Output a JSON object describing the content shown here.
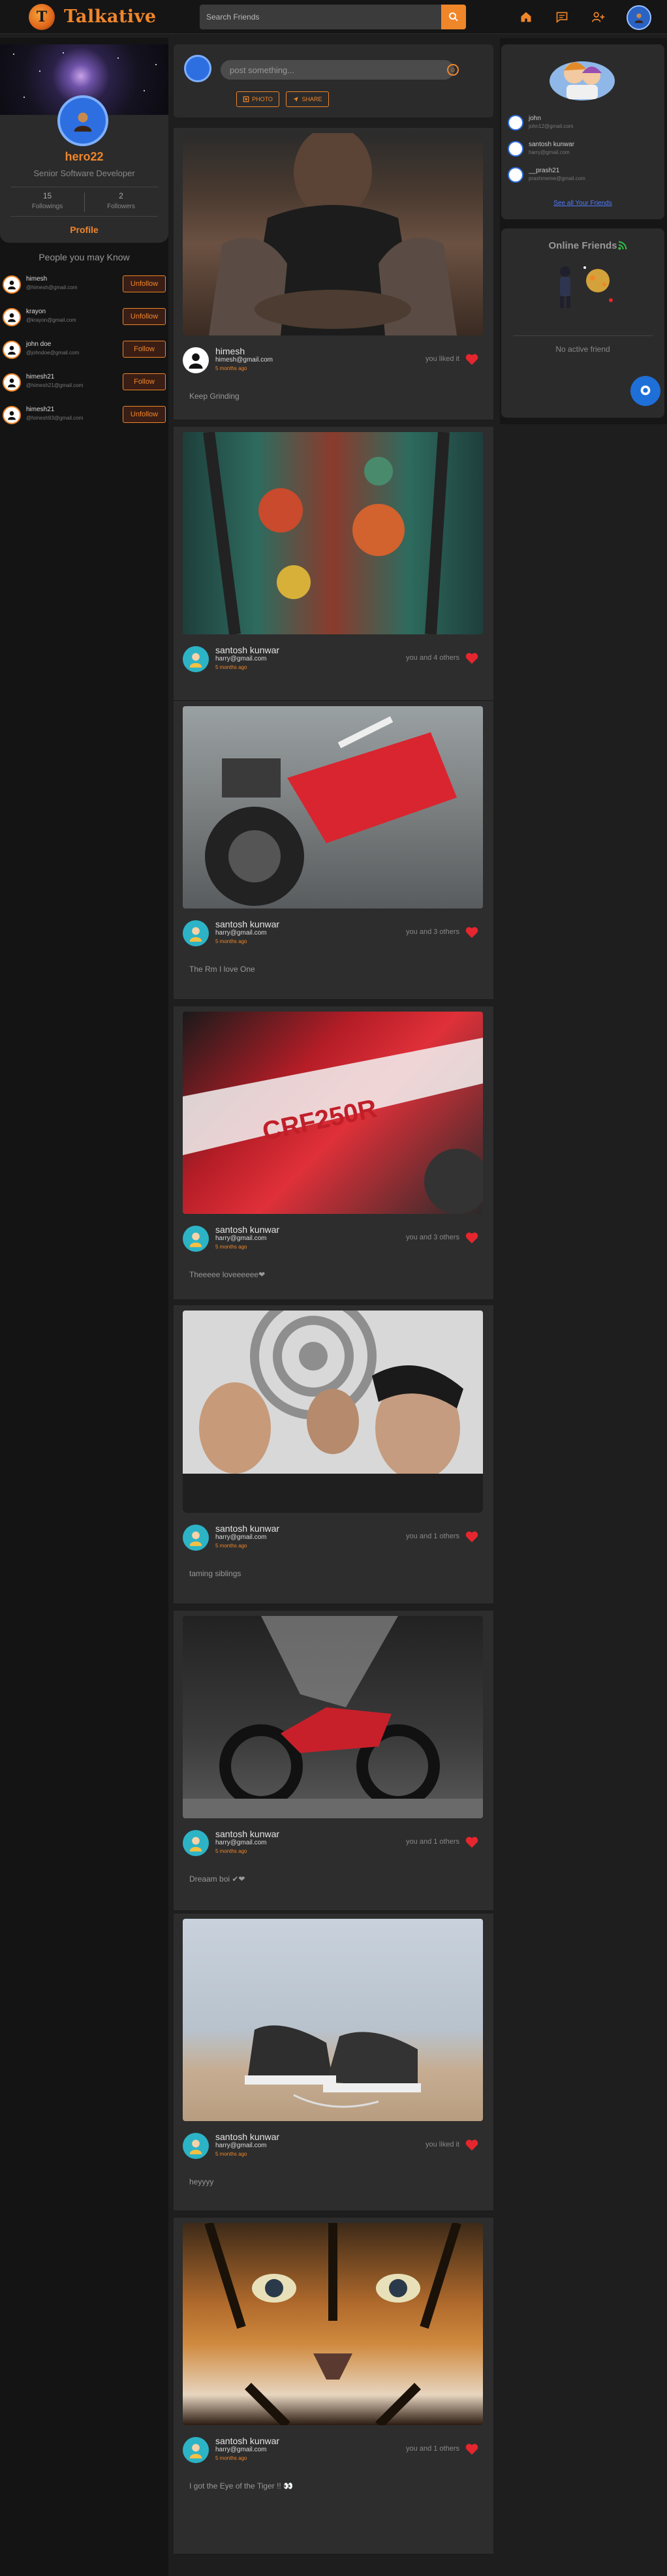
{
  "navbar": {
    "brand": "Talkative",
    "logo_letter": "T",
    "search_placeholder": "Search Friends",
    "icons": [
      "search-icon",
      "home-icon",
      "chat-icon",
      "person-add-icon",
      "user-avatar"
    ]
  },
  "profile": {
    "name": "hero22",
    "title": "Senior Software Developer",
    "followings_count": "15",
    "followings_label": "Followings",
    "followers_count": "2",
    "followers_label": "Followers",
    "link_label": "Profile"
  },
  "people_you_may_know": {
    "title": "People you may Know",
    "items": [
      {
        "name": "himesh",
        "email": "@himesh@gmail.com",
        "action": "Unfollow"
      },
      {
        "name": "krayon",
        "email": "@krayon@gmail.com",
        "action": "Unfollow"
      },
      {
        "name": "john doe",
        "email": "@johndoe@gmail.com",
        "action": "Follow"
      },
      {
        "name": "himesh21",
        "email": "@himesh21@gmail.com",
        "action": "Follow"
      },
      {
        "name": "himesh21",
        "email": "@himesh93@gmail.com",
        "action": "Unfollow"
      }
    ]
  },
  "composer": {
    "placeholder": "post something...",
    "photo_label": "PHOTO",
    "share_label": "SHARE"
  },
  "posts": [
    {
      "name": "himesh",
      "email": "himesh@gmail.com",
      "time": "5 months ago",
      "likes": "you liked it",
      "caption": "Keep Grinding",
      "image": "tattooed-man"
    },
    {
      "name": "santosh kunwar",
      "email": "harry@gmail.com",
      "time": "5 months ago",
      "likes": "you and 4 others",
      "caption": "",
      "image": "tattooed-legs"
    },
    {
      "name": "santosh kunwar",
      "email": "harry@gmail.com",
      "time": "5 months ago",
      "likes": "you and 3 others",
      "caption": "The Rm I love One",
      "image": "motorbike-rear"
    },
    {
      "name": "santosh kunwar",
      "email": "harry@gmail.com",
      "time": "5 months ago",
      "likes": "you and 3 others",
      "caption": "Theeeee loveeeeee❤",
      "image": "motorbike-closeup"
    },
    {
      "name": "santosh kunwar",
      "email": "harry@gmail.com",
      "time": "5 months ago",
      "likes": "you and 1 others",
      "caption": "taming siblings",
      "image": "three-friends"
    },
    {
      "name": "santosh kunwar",
      "email": "harry@gmail.com",
      "time": "5 months ago",
      "likes": "you and 1 others",
      "caption": "Dreaam boi ✔❤",
      "image": "motorbike-studio"
    },
    {
      "name": "santosh kunwar",
      "email": "harry@gmail.com",
      "time": "5 months ago",
      "likes": "you liked it",
      "caption": "heyyyy",
      "image": "sneakers"
    },
    {
      "name": "santosh kunwar",
      "email": "harry@gmail.com",
      "time": "5 months ago",
      "likes": "you and 1 others",
      "caption": "I got the Eye of the Tiger !! 👀",
      "image": "tiger-face"
    }
  ],
  "friends": {
    "items": [
      {
        "name": "john",
        "email": "john12@gmail.com"
      },
      {
        "name": "santosh kunwar",
        "email": "harry@gmail.com"
      },
      {
        "name": "__prash21",
        "email": "prashmeme@gmail.com"
      }
    ],
    "see_all": "See all Your Friends"
  },
  "online": {
    "title": "Online Friends",
    "empty_text": "No active friend"
  },
  "colors": {
    "accent": "#f0862a",
    "like_heart": "#e5262e",
    "link": "#4f7bff",
    "chat_fab": "#1e6fd8"
  }
}
